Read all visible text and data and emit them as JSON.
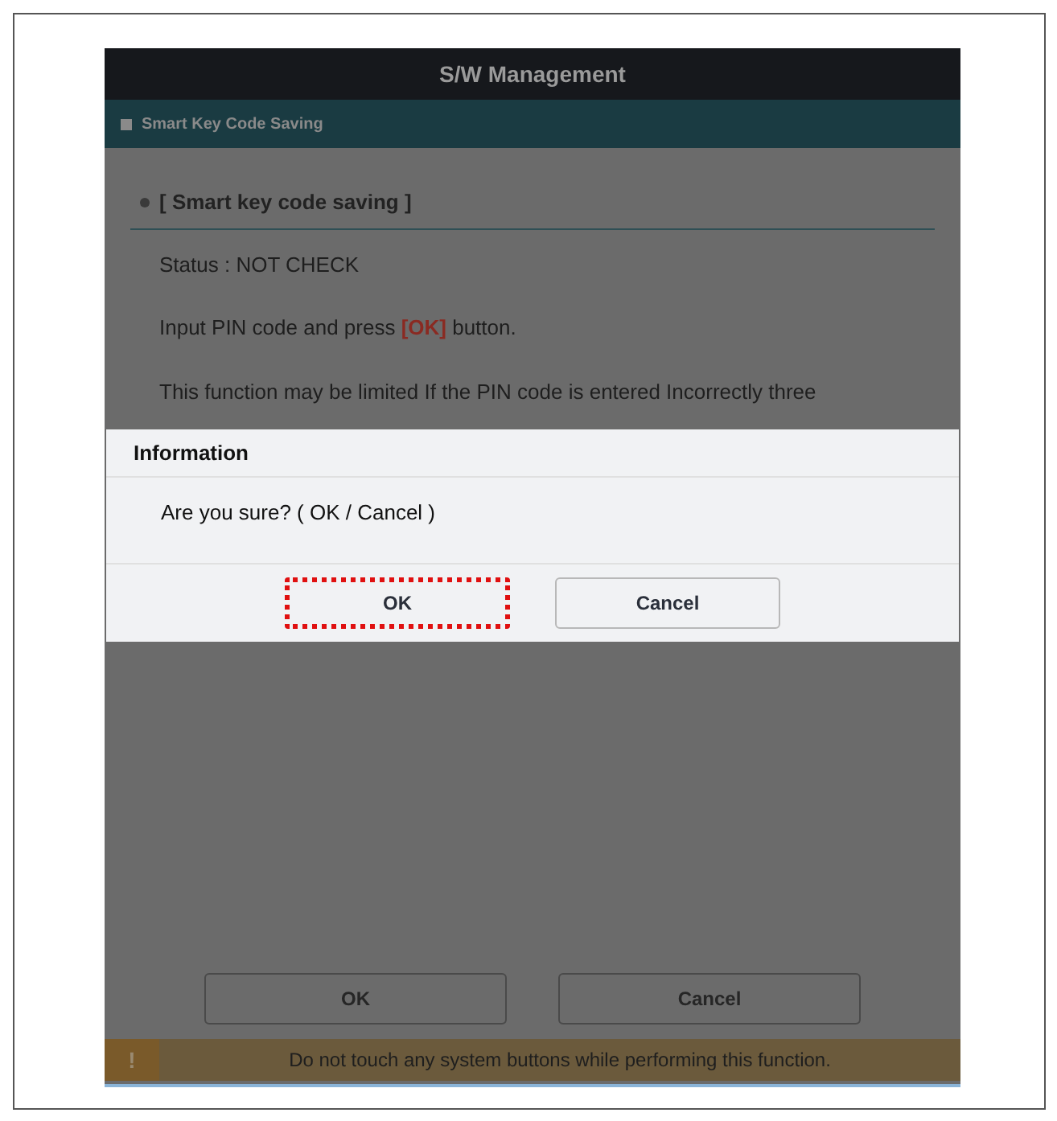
{
  "window": {
    "title": "S/W Management"
  },
  "section": {
    "title": "Smart Key Code Saving"
  },
  "content": {
    "heading": "[ Smart key code saving ]",
    "lines": [
      {
        "kind": "plain",
        "text": "Status : NOT CHECK"
      },
      {
        "kind": "emphasis",
        "before": "Input PIN code and press ",
        "highlight": "[OK]",
        "after": " button."
      },
      {
        "kind": "plain",
        "text": "This function may be limited If the PIN code is entered Incorrectly three"
      }
    ]
  },
  "dialog": {
    "title": "Information",
    "message": "Are you sure? ( OK / Cancel )",
    "buttons": [
      {
        "label": "OK",
        "highlighted": true
      },
      {
        "label": "Cancel",
        "highlighted": false
      }
    ]
  },
  "buttons": [
    "OK",
    "Cancel"
  ],
  "warning": {
    "icon": "!",
    "text": "Do not touch any system buttons while performing this function."
  }
}
